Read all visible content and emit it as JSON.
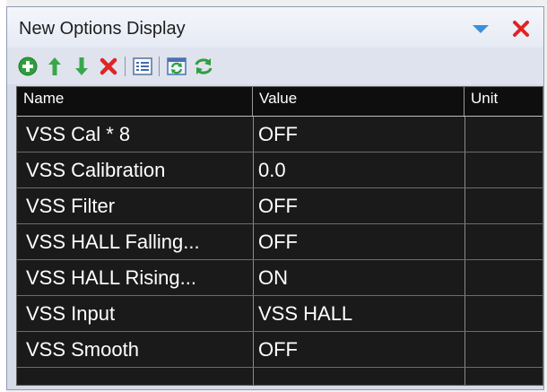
{
  "window": {
    "title": "New Options Display"
  },
  "icons": {
    "dropdown": "dropdown-triangle-icon",
    "close": "close-icon",
    "add": "add-icon",
    "move_up": "arrow-up-icon",
    "move_down": "arrow-down-icon",
    "delete": "delete-icon",
    "list": "list-icon",
    "refresh": "refresh-icon",
    "sync": "sync-icon"
  },
  "colors": {
    "grid_background": "#1a1a1a",
    "grid_text": "#ffffff",
    "toolbar_green": "#2e9e3e",
    "delete_red": "#e02424"
  },
  "grid": {
    "columns": [
      {
        "label": "Name"
      },
      {
        "label": "Value"
      },
      {
        "label": "Unit"
      }
    ],
    "rows": [
      {
        "name": "VSS Cal * 8",
        "value": "OFF",
        "unit": ""
      },
      {
        "name": "VSS Calibration",
        "value": "0.0",
        "unit": ""
      },
      {
        "name": "VSS Filter",
        "value": "OFF",
        "unit": ""
      },
      {
        "name": "VSS HALL Falling...",
        "value": "OFF",
        "unit": ""
      },
      {
        "name": "VSS HALL Rising...",
        "value": "ON",
        "unit": ""
      },
      {
        "name": "VSS Input",
        "value": "VSS HALL",
        "unit": ""
      },
      {
        "name": "VSS Smooth",
        "value": "OFF",
        "unit": ""
      }
    ]
  }
}
